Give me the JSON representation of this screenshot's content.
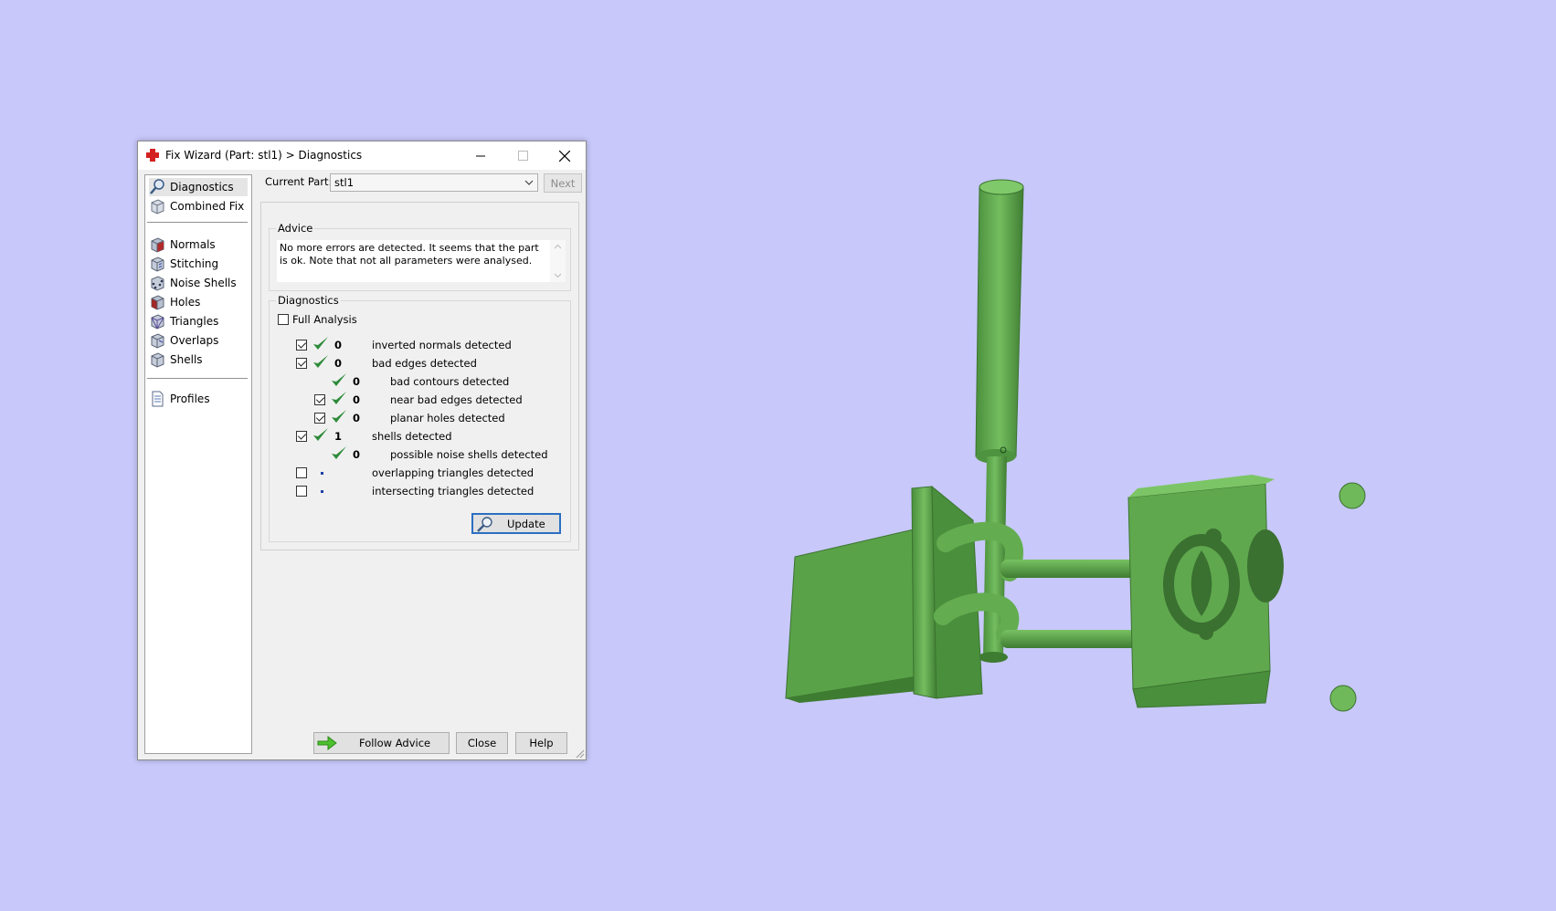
{
  "window": {
    "title": "Fix Wizard (Part: stl1) > Diagnostics",
    "minimize_icon": "minimize-icon",
    "maximize_icon": "maximize-icon",
    "close_icon": "close-icon"
  },
  "sidebar": {
    "items": [
      {
        "label": "Diagnostics",
        "icon": "magnifier-icon",
        "active": true
      },
      {
        "label": "Combined Fix",
        "icon": "cube-wire-icon"
      },
      {
        "label": "Normals",
        "icon": "cube-red-icon"
      },
      {
        "label": "Stitching",
        "icon": "cube-stitch-icon"
      },
      {
        "label": "Noise Shells",
        "icon": "cube-dots-icon"
      },
      {
        "label": "Holes",
        "icon": "cube-hole-icon"
      },
      {
        "label": "Triangles",
        "icon": "cube-triangle-icon"
      },
      {
        "label": "Overlaps",
        "icon": "cube-overlap-icon"
      },
      {
        "label": "Shells",
        "icon": "cube-shell-icon"
      },
      {
        "label": "Profiles",
        "icon": "document-icon"
      }
    ]
  },
  "header": {
    "current_part_label": "Current Part:",
    "current_part_value": "stl1",
    "next_label": "Next"
  },
  "advice": {
    "title": "Advice",
    "text": "No more errors are detected. It seems that the part is ok. Note that not all parameters were analysed."
  },
  "diagnostics": {
    "title": "Diagnostics",
    "full_analysis_label": "Full Analysis",
    "full_analysis_checked": false,
    "rows": [
      {
        "checkbox": true,
        "checked": true,
        "status": "ok",
        "count": "0",
        "label": "inverted normals detected",
        "indent": 0
      },
      {
        "checkbox": true,
        "checked": true,
        "status": "ok",
        "count": "0",
        "label": "bad edges detected",
        "indent": 0
      },
      {
        "checkbox": false,
        "checked": false,
        "status": "ok",
        "count": "0",
        "label": "bad contours detected",
        "indent": 1
      },
      {
        "checkbox": true,
        "checked": true,
        "status": "ok",
        "count": "0",
        "label": "near bad edges detected",
        "indent": 1
      },
      {
        "checkbox": true,
        "checked": true,
        "status": "ok",
        "count": "0",
        "label": "planar holes detected",
        "indent": 1
      },
      {
        "checkbox": true,
        "checked": true,
        "status": "ok",
        "count": "1",
        "label": "shells detected",
        "indent": 0
      },
      {
        "checkbox": false,
        "checked": false,
        "status": "ok",
        "count": "0",
        "label": "possible noise shells detected",
        "indent": 1
      },
      {
        "checkbox": true,
        "checked": false,
        "status": "none",
        "count": "",
        "label": "overlapping triangles detected",
        "indent": 0
      },
      {
        "checkbox": true,
        "checked": false,
        "status": "none",
        "count": "",
        "label": "intersecting triangles detected",
        "indent": 0
      }
    ],
    "update_label": "Update"
  },
  "footer": {
    "follow_advice_label": "Follow Advice",
    "close_label": "Close",
    "help_label": "Help"
  },
  "colors": {
    "background": "#c8c8fa",
    "model": "#5fa84e",
    "check_green": "#2e8b3a"
  }
}
